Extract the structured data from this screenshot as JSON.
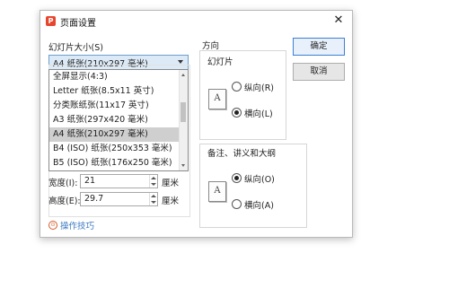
{
  "dialog": {
    "title": "页面设置",
    "close_glyph": "✕",
    "app_icon": "wps-presentation-icon"
  },
  "slide_size": {
    "label": "幻灯片大小(S)",
    "selected": "A4 纸张(210x297 毫米)",
    "options": [
      "全屏显示(4:3)",
      "Letter 纸张(8.5x11 英寸)",
      "分类账纸张(11x17 英寸)",
      "A3 纸张(297x420 毫米)",
      "A4 纸张(210x297 毫米)",
      "B4 (ISO) 纸张(250x353 毫米)",
      "B5 (ISO) 纸张(176x250 毫米)"
    ],
    "highlighted_index": 4
  },
  "dimensions": {
    "width_label": "宽度(I):",
    "width_value": "21",
    "height_label": "高度(E):",
    "height_value": "29.7",
    "unit": "厘米"
  },
  "orientation": {
    "group_label": "方向",
    "slides": {
      "label": "幻灯片",
      "portrait": "纵向(R)",
      "landscape": "横向(L)",
      "selected": "landscape",
      "icon_letter": "A"
    },
    "notes": {
      "label": "备注、讲义和大纲",
      "portrait": "纵向(O)",
      "landscape": "横向(A)",
      "selected": "portrait",
      "icon_letter": "A"
    }
  },
  "buttons": {
    "ok": "确定",
    "cancel": "取消"
  },
  "tips": {
    "label": "操作技巧",
    "icon": "tips-icon"
  }
}
